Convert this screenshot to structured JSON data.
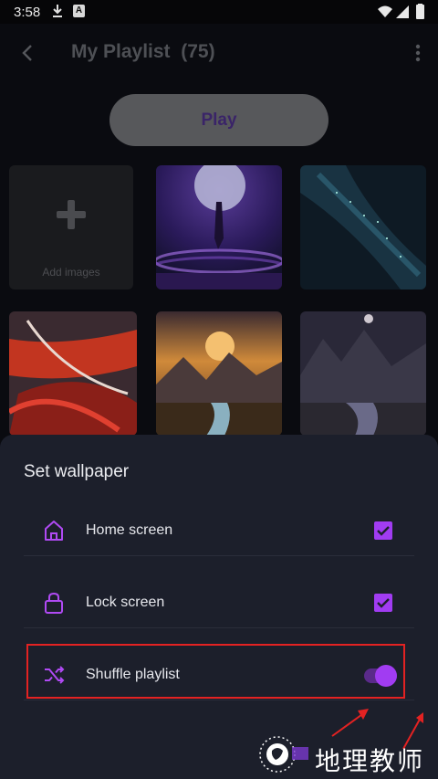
{
  "status_bar": {
    "time": "3:58",
    "notif_icon_a": "A"
  },
  "app_bar": {
    "title": "My Playlist",
    "count": "(75)"
  },
  "play_button": {
    "label": "Play"
  },
  "add_images": {
    "label": "Add images"
  },
  "sheet": {
    "title": "Set wallpaper",
    "rows": [
      {
        "label": "Home screen",
        "icon": "home-icon",
        "checked": true
      },
      {
        "label": "Lock screen",
        "icon": "lock-icon",
        "checked": true
      },
      {
        "label": "Shuffle playlist",
        "icon": "shuffle-icon",
        "toggle_on": true
      }
    ]
  },
  "colors": {
    "accent": "#a13cf2",
    "sheet_bg": "#1c1f2b",
    "highlight": "#e32222"
  },
  "watermark": {
    "text": "地理教师"
  }
}
